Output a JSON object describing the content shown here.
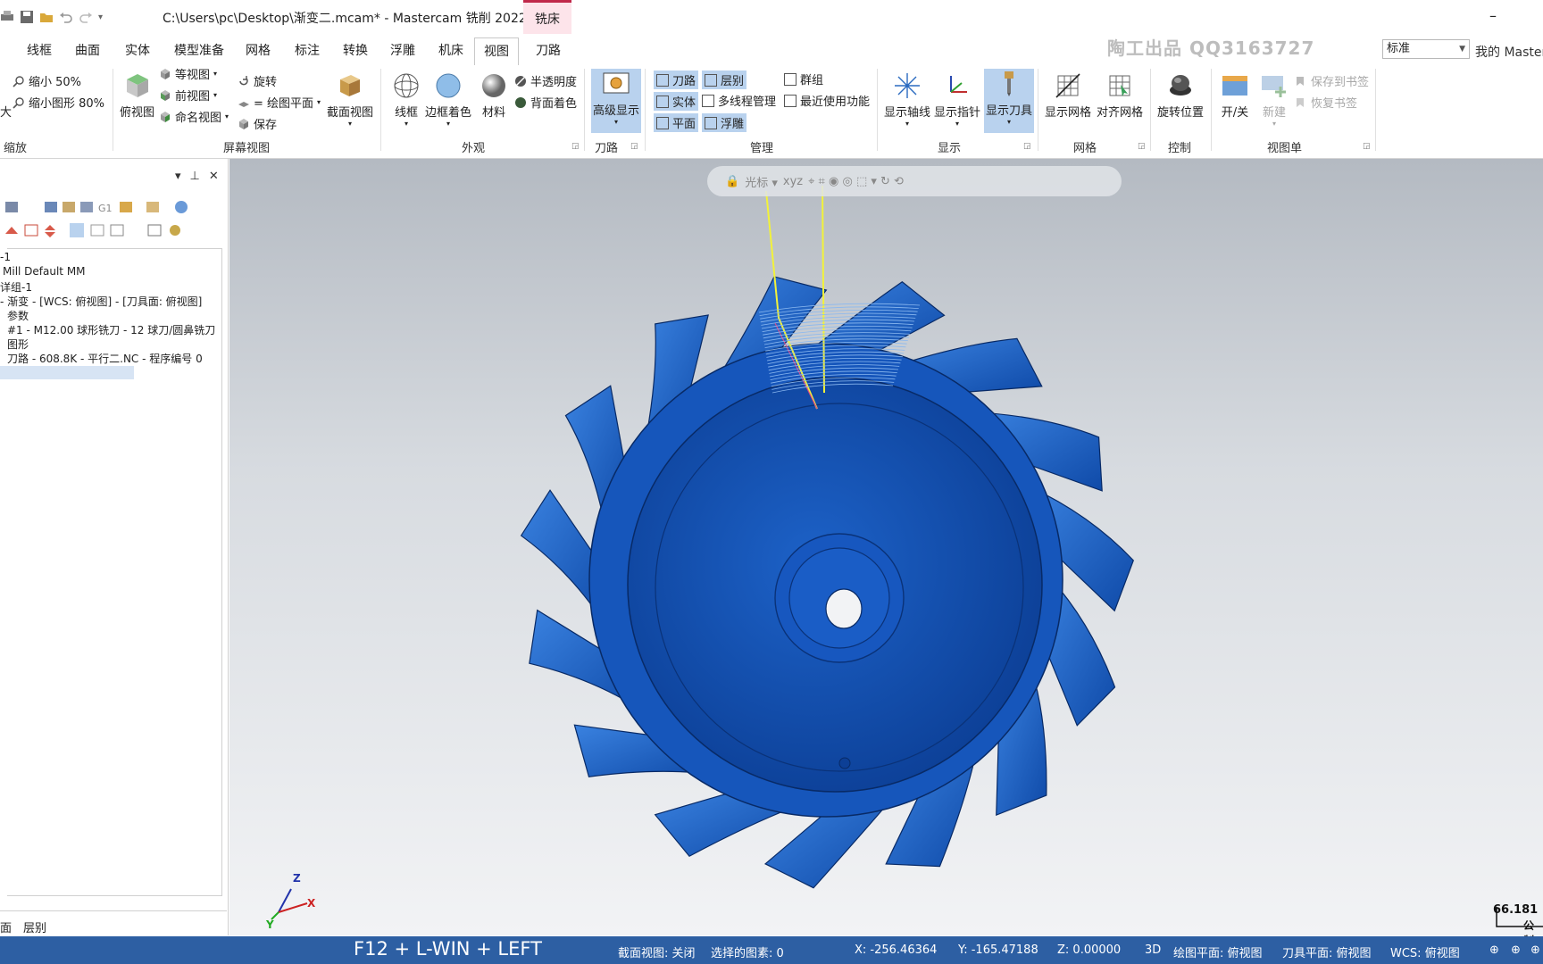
{
  "window": {
    "title": "C:\\Users\\pc\\Desktop\\渐变二.mcam* - Mastercam 铣削 2022",
    "context_tab": "铣床",
    "minimize": "–"
  },
  "tabs": [
    "线框",
    "曲面",
    "实体",
    "模型准备",
    "网格",
    "标注",
    "转换",
    "浮雕",
    "机床",
    "视图",
    "刀路"
  ],
  "active_tab": "视图",
  "watermark": "陶工出品 QQ3163727",
  "style_select": "标准",
  "my_mastercam": "我的 Mastercam",
  "ribbon": {
    "zoom": {
      "label": "缩放",
      "cut_left": "大",
      "shrink": "缩小 50%",
      "shrink_figure": "缩小图形 80%"
    },
    "screen_view": {
      "label": "屏幕视图",
      "top_view": "俯视图",
      "iso_view": "等视图",
      "front_view": "前视图",
      "named_view": "命名视图",
      "rotate": "旋转",
      "plane": "= 绘图平面",
      "save": "保存",
      "section_view": "截面视图"
    },
    "appearance": {
      "label": "外观",
      "wireframe": "线框",
      "edge_shade": "边框着色",
      "material": "材料",
      "translucency": "半透明度",
      "back_color": "背面着色"
    },
    "toolpath": {
      "label": "刀路",
      "advanced_display": "高级显示"
    },
    "manage": {
      "label": "管理",
      "toolpaths": "刀路",
      "levels": "层别",
      "groups": "群组",
      "solids": "实体",
      "multithread": "多线程管理",
      "recent": "最近使用功能",
      "planes": "平面",
      "relief": "浮雕"
    },
    "display": {
      "label": "显示",
      "show_axes": "显示轴线",
      "show_gnomon": "显示指针",
      "show_tool": "显示刀具"
    },
    "grid": {
      "label": "网格",
      "show_grid": "显示网格",
      "snap_grid": "对齐网格"
    },
    "control": {
      "label": "控制",
      "rotate_position": "旋转位置"
    },
    "viewsheets": {
      "label": "视图单",
      "on_off": "开/关",
      "new": "新建",
      "save_bookmark": "保存到书签",
      "restore_bookmark": "恢复书签"
    }
  },
  "tree": {
    "items": [
      "-1",
      "Mill Default MM",
      "详组-1",
      "- 渐变 - [WCS: 俯视图] - [刀具面: 俯视图]",
      "参数",
      "#1 - M12.00 球形铣刀 - 12 球刀/圆鼻铣刀",
      "图形",
      "刀路 - 608.8K - 平行二.NC - 程序编号 0"
    ],
    "bottom_tabs": [
      "面",
      "层别"
    ]
  },
  "viewport": {
    "cursor_label": "光标",
    "xyz_label": "xyz",
    "scale_value": "66.181",
    "scale_unit": "公制",
    "triad": {
      "z": "Z",
      "x": "X",
      "y": "Y"
    },
    "model_color": "#1a5fc4",
    "toolpath_line_color": "#f2f23a"
  },
  "status": {
    "shortcut_overlay": "F12 + L-WIN + LEFT",
    "section_view": "截面视图: 关闭",
    "selected": "选择的图素: 0",
    "x": "X:   -256.46364",
    "y": "Y:   -165.47188",
    "z": "Z:   0.00000",
    "mode": "3D",
    "draw_plane": "绘图平面: 俯视图",
    "tool_plane": "刀具平面: 俯视图",
    "wcs": "WCS: 俯视图"
  },
  "colors": {
    "statusbar": "#2d5fa3",
    "highlight": "#b9d2ee",
    "active_tab_border": "#c0284a"
  }
}
